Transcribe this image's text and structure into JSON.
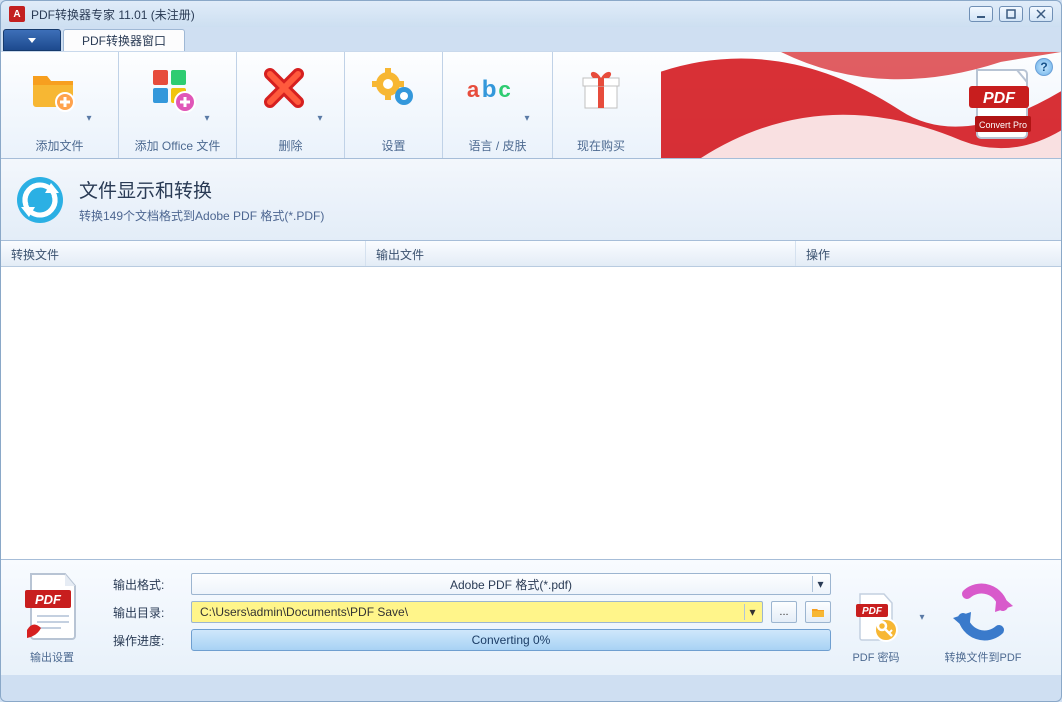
{
  "title": "PDF转换器专家 11.01 (未注册)",
  "tab": "PDF转换器窗口",
  "ribbon": {
    "add_file": "添加文件",
    "add_office": "添加 Office 文件",
    "delete": "删除",
    "settings": "设置",
    "lang_skin": "语言 / 皮肤",
    "buy_now": "现在购买"
  },
  "panel": {
    "title": "文件显示和转换",
    "subtitle": "转换149个文档格式到Adobe PDF 格式(*.PDF)"
  },
  "columns": {
    "convert_file": "转换文件",
    "output_file": "输出文件",
    "operation": "操作"
  },
  "bottom": {
    "output_settings": "输出设置",
    "out_format_label": "输出格式:",
    "out_format_value": "Adobe PDF 格式(*.pdf)",
    "out_dir_label": "输出目录:",
    "out_dir_value": "C:\\Users\\admin\\Documents\\PDF Save\\",
    "progress_label": "操作进度:",
    "progress_text": "Converting 0%",
    "pdf_password": "PDF 密码",
    "convert_to_pdf": "转换文件到PDF",
    "browse": "..."
  }
}
